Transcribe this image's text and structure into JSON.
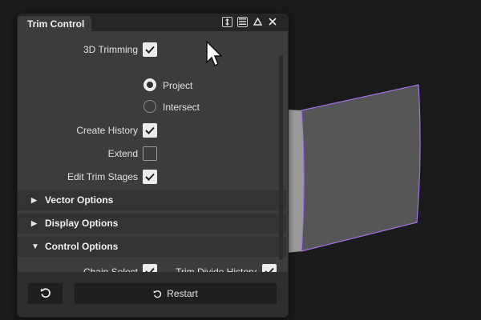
{
  "panel": {
    "title": "Trim Control",
    "titlebar_icons": [
      "expand-vertical-icon",
      "menu-icon",
      "collapse-icon",
      "close-icon"
    ],
    "rows": {
      "trimming_3d": {
        "label": "3D Trimming",
        "checked": true
      },
      "radio_project": {
        "label": "Project",
        "selected": true
      },
      "radio_intersect": {
        "label": "Intersect",
        "selected": false
      },
      "create_history": {
        "label": "Create History",
        "checked": true
      },
      "extend": {
        "label": "Extend",
        "checked": false
      },
      "edit_trim_stages": {
        "label": "Edit Trim Stages",
        "checked": true
      }
    },
    "sections": {
      "vector_options": {
        "label": "Vector Options",
        "expanded": false
      },
      "display_options": {
        "label": "Display Options",
        "expanded": false
      },
      "control_options": {
        "label": "Control Options",
        "expanded": true
      }
    },
    "control_options": {
      "chain_select": {
        "label": "Chain Select",
        "checked": true
      },
      "trim_divide_history": {
        "label": "Trim Divide History",
        "checked": true
      }
    },
    "footer": {
      "reset_icon": "reset-icon",
      "restart_label": "Restart"
    }
  },
  "colors": {
    "panel_bg": "#3c3c3c",
    "section_bg": "#333333",
    "surface_outline": "#a070e8",
    "viewport_bg": "#1a1a1a"
  }
}
